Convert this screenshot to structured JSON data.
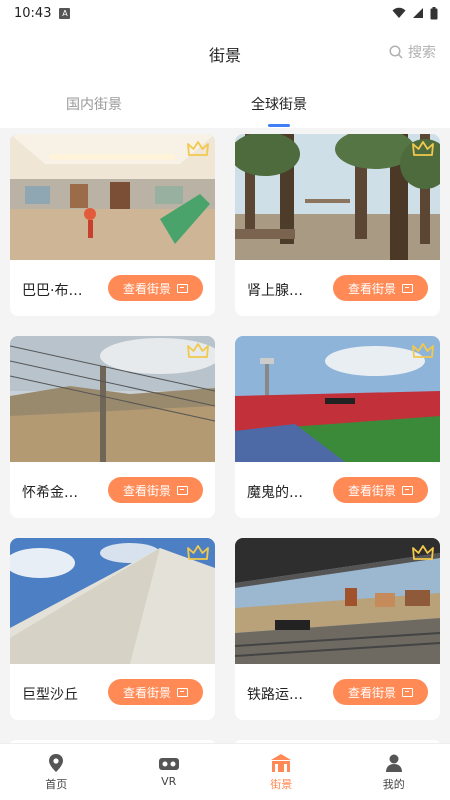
{
  "status": {
    "time": "10:43",
    "a_badge": "A"
  },
  "header": {
    "title": "街景",
    "search_label": "搜索"
  },
  "tabs": [
    {
      "label": "国内街景",
      "active": false
    },
    {
      "label": "全球街景",
      "active": true
    }
  ],
  "cards": [
    {
      "name": "巴巴·布…",
      "button": "查看街景",
      "scene": "interior"
    },
    {
      "name": "肾上腺…",
      "button": "查看街景",
      "scene": "forest"
    },
    {
      "name": "怀希金…",
      "button": "查看街景",
      "scene": "fence"
    },
    {
      "name": "魔鬼的…",
      "button": "查看街景",
      "scene": "stadium"
    },
    {
      "name": "巨型沙丘",
      "button": "查看街景",
      "scene": "dune"
    },
    {
      "name": "铁路运…",
      "button": "查看街景",
      "scene": "railway"
    }
  ],
  "bottom_nav": [
    {
      "label": "首页",
      "icon": "location-pin-icon",
      "active": false
    },
    {
      "label": "VR",
      "icon": "vr-headset-icon",
      "active": false
    },
    {
      "label": "街景",
      "icon": "building-icon",
      "active": true
    },
    {
      "label": "我的",
      "icon": "person-icon",
      "active": false
    }
  ],
  "colors": {
    "accent": "#ff8a55",
    "tab_indicator": "#3f7ff3",
    "crown": "#f2c94c"
  }
}
